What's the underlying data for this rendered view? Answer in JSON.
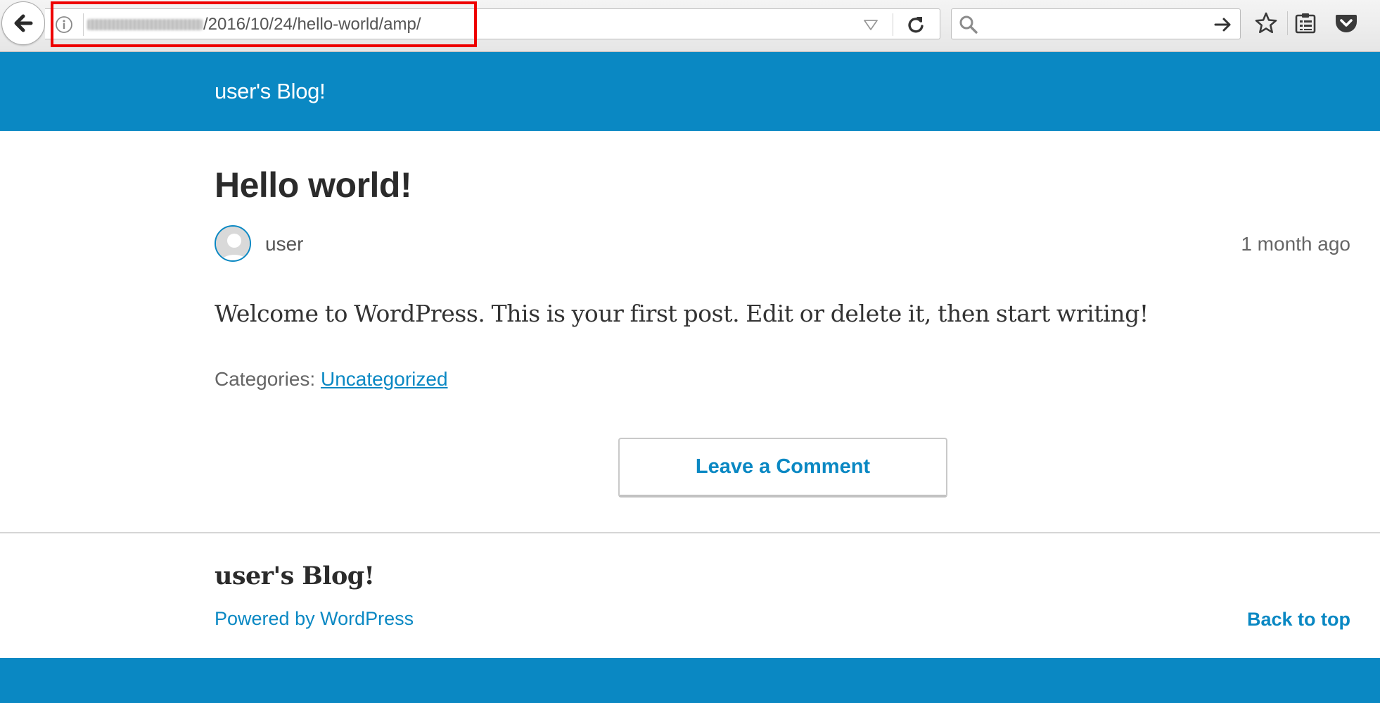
{
  "browser": {
    "url_path": "/2016/10/24/hello-world/amp/",
    "search_value": ""
  },
  "header": {
    "site_title": "user's Blog!"
  },
  "post": {
    "title": "Hello world!",
    "author": "user",
    "date": "1 month ago",
    "body": "Welcome to WordPress. This is your first post. Edit or delete it, then start writing!",
    "categories_label": "Categories:",
    "category": "Uncategorized",
    "comment_button": "Leave a Comment"
  },
  "footer": {
    "site_title": "user's Blog!",
    "powered_by": "Powered by WordPress",
    "back_to_top": "Back to top"
  },
  "colors": {
    "brand_blue": "#0a88c3",
    "highlight_red": "#ee0000"
  }
}
